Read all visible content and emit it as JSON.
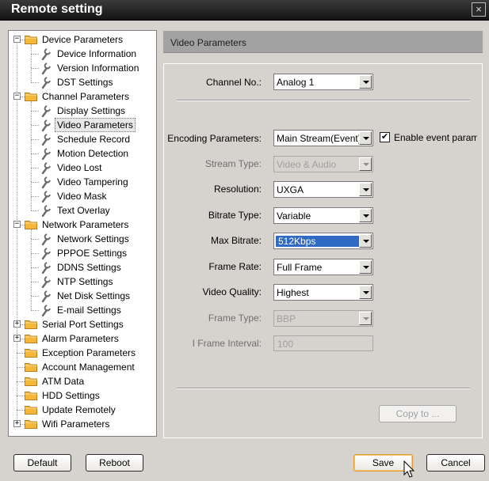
{
  "window": {
    "title": "Remote setting",
    "close_glyph": "×"
  },
  "tree": [
    {
      "label": "Device Parameters",
      "level": 0,
      "expander": "minus",
      "icon": "folder-icon"
    },
    {
      "label": "Device Information",
      "level": 1,
      "icon": "wrench-icon"
    },
    {
      "label": "Version Information",
      "level": 1,
      "icon": "wrench-icon"
    },
    {
      "label": "DST Settings",
      "level": 1,
      "icon": "wrench-icon"
    },
    {
      "label": "Channel Parameters",
      "level": 0,
      "expander": "minus",
      "icon": "folder-icon"
    },
    {
      "label": "Display Settings",
      "level": 1,
      "icon": "wrench-icon"
    },
    {
      "label": "Video Parameters",
      "level": 1,
      "icon": "wrench-icon",
      "selected": true
    },
    {
      "label": "Schedule Record",
      "level": 1,
      "icon": "wrench-icon"
    },
    {
      "label": "Motion Detection",
      "level": 1,
      "icon": "wrench-icon"
    },
    {
      "label": "Video Lost",
      "level": 1,
      "icon": "wrench-icon"
    },
    {
      "label": "Video Tampering",
      "level": 1,
      "icon": "wrench-icon"
    },
    {
      "label": "Video Mask",
      "level": 1,
      "icon": "wrench-icon"
    },
    {
      "label": "Text Overlay",
      "level": 1,
      "icon": "wrench-icon"
    },
    {
      "label": "Network Parameters",
      "level": 0,
      "expander": "minus",
      "icon": "folder-icon"
    },
    {
      "label": "Network Settings",
      "level": 1,
      "icon": "wrench-icon"
    },
    {
      "label": "PPPOE Settings",
      "level": 1,
      "icon": "wrench-icon"
    },
    {
      "label": "DDNS Settings",
      "level": 1,
      "icon": "wrench-icon"
    },
    {
      "label": "NTP Settings",
      "level": 1,
      "icon": "wrench-icon"
    },
    {
      "label": "Net Disk Settings",
      "level": 1,
      "icon": "wrench-icon"
    },
    {
      "label": "E-mail Settings",
      "level": 1,
      "icon": "wrench-icon"
    },
    {
      "label": "Serial Port Settings",
      "level": 0,
      "expander": "plus",
      "icon": "folder-icon"
    },
    {
      "label": "Alarm Parameters",
      "level": 0,
      "expander": "plus",
      "icon": "folder-icon"
    },
    {
      "label": "Exception Parameters",
      "level": 0,
      "icon": "folder-icon"
    },
    {
      "label": "Account Management",
      "level": 0,
      "icon": "folder-icon"
    },
    {
      "label": "ATM Data",
      "level": 0,
      "icon": "folder-icon"
    },
    {
      "label": "HDD Settings",
      "level": 0,
      "icon": "folder-icon"
    },
    {
      "label": "Update Remotely",
      "level": 0,
      "icon": "folder-icon"
    },
    {
      "label": "Wifi Parameters",
      "level": 0,
      "expander": "plus",
      "icon": "folder-icon"
    }
  ],
  "panel": {
    "title": "Video Parameters",
    "channel": {
      "label": "Channel No.:",
      "value": "Analog 1"
    },
    "encoding": {
      "label": "Encoding Parameters:",
      "value": "Main Stream(Event)",
      "checkbox_label": "Enable event parameters",
      "checked": true,
      "check_glyph": "✔"
    },
    "stream_type": {
      "label": "Stream Type:",
      "value": "Video & Audio",
      "disabled": true
    },
    "resolution": {
      "label": "Resolution:",
      "value": "UXGA"
    },
    "bitrate_type": {
      "label": "Bitrate Type:",
      "value": "Variable"
    },
    "max_bitrate": {
      "label": "Max Bitrate:",
      "value": "512Kbps",
      "focused": true
    },
    "frame_rate": {
      "label": "Frame Rate:",
      "value": "Full Frame"
    },
    "video_quality": {
      "label": "Video Quality:",
      "value": "Highest"
    },
    "frame_type": {
      "label": "Frame Type:",
      "value": "BBP",
      "disabled": true
    },
    "i_frame_interval": {
      "label": "I Frame Interval:",
      "value": "100",
      "disabled": true
    },
    "copy_button": "Copy to ..."
  },
  "buttons": {
    "default": "Default",
    "reboot": "Reboot",
    "save": "Save",
    "cancel": "Cancel"
  }
}
